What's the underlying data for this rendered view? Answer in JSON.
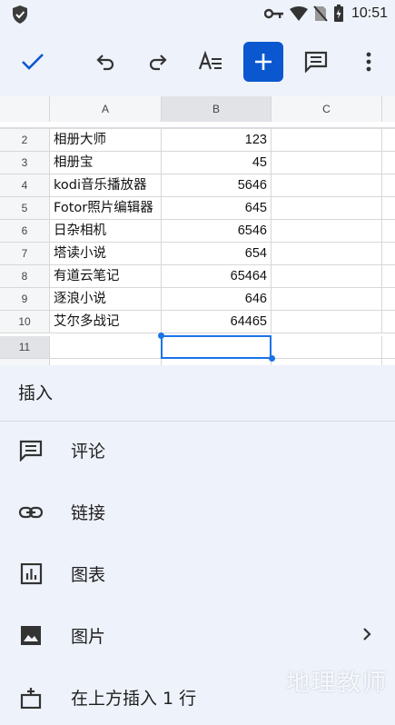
{
  "status_bar": {
    "time": "10:51"
  },
  "toolbar": {
    "icons": [
      "check-icon",
      "undo-icon",
      "redo-icon",
      "text-format-icon",
      "add-icon",
      "comment-icon",
      "more-vert-icon"
    ],
    "accent": "#0b57d0"
  },
  "sheet": {
    "columns": [
      "A",
      "B",
      "C"
    ],
    "selected_column": "B",
    "rows": [
      {
        "num": "2",
        "a": "相册大师",
        "b": "123"
      },
      {
        "num": "3",
        "a": "相册宝",
        "b": "45"
      },
      {
        "num": "4",
        "a": "kodi音乐播放器",
        "b": "5646"
      },
      {
        "num": "5",
        "a": "Fotor照片编辑器",
        "b": "645"
      },
      {
        "num": "6",
        "a": "日杂相机",
        "b": "6546"
      },
      {
        "num": "7",
        "a": "塔读小说",
        "b": "654"
      },
      {
        "num": "8",
        "a": "有道云笔记",
        "b": "65464"
      },
      {
        "num": "9",
        "a": "逐浪小说",
        "b": "646"
      },
      {
        "num": "10",
        "a": "艾尔多战记",
        "b": "64465"
      },
      {
        "num": "11",
        "a": "",
        "b": ""
      }
    ],
    "selected_cell": "B11"
  },
  "insert_panel": {
    "title": "插入",
    "items": [
      {
        "label": "评论",
        "icon": "comment-icon"
      },
      {
        "label": "链接",
        "icon": "link-icon"
      },
      {
        "label": "图表",
        "icon": "chart-icon"
      },
      {
        "label": "图片",
        "icon": "image-icon",
        "has_submenu": true
      },
      {
        "label": "在上方插入 1 行",
        "icon": "insert-row-above-icon"
      }
    ]
  },
  "watermark": "地理教师"
}
